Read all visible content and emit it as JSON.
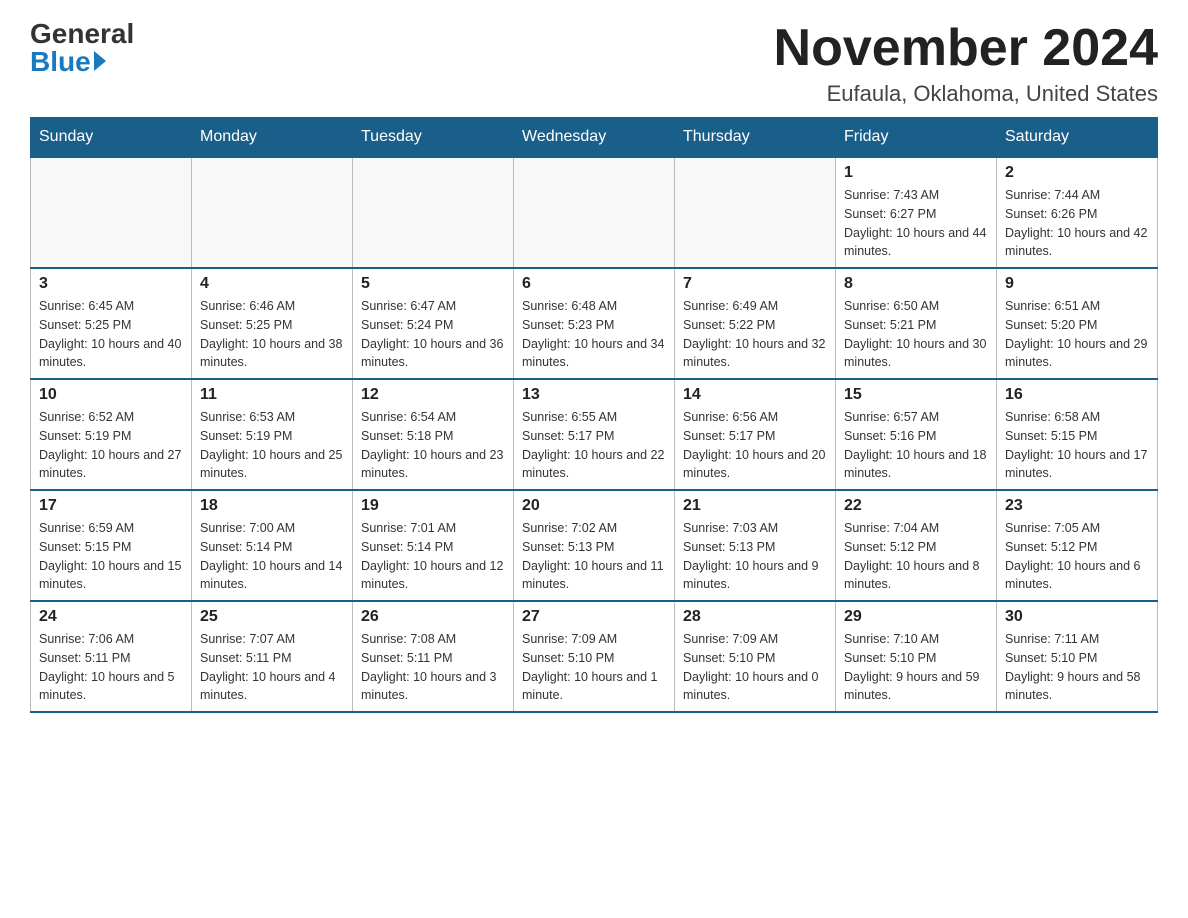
{
  "header": {
    "logo_general": "General",
    "logo_blue": "Blue",
    "month_title": "November 2024",
    "location": "Eufaula, Oklahoma, United States"
  },
  "weekdays": [
    "Sunday",
    "Monday",
    "Tuesday",
    "Wednesday",
    "Thursday",
    "Friday",
    "Saturday"
  ],
  "weeks": [
    [
      {
        "day": "",
        "info": ""
      },
      {
        "day": "",
        "info": ""
      },
      {
        "day": "",
        "info": ""
      },
      {
        "day": "",
        "info": ""
      },
      {
        "day": "",
        "info": ""
      },
      {
        "day": "1",
        "info": "Sunrise: 7:43 AM\nSunset: 6:27 PM\nDaylight: 10 hours and 44 minutes."
      },
      {
        "day": "2",
        "info": "Sunrise: 7:44 AM\nSunset: 6:26 PM\nDaylight: 10 hours and 42 minutes."
      }
    ],
    [
      {
        "day": "3",
        "info": "Sunrise: 6:45 AM\nSunset: 5:25 PM\nDaylight: 10 hours and 40 minutes."
      },
      {
        "day": "4",
        "info": "Sunrise: 6:46 AM\nSunset: 5:25 PM\nDaylight: 10 hours and 38 minutes."
      },
      {
        "day": "5",
        "info": "Sunrise: 6:47 AM\nSunset: 5:24 PM\nDaylight: 10 hours and 36 minutes."
      },
      {
        "day": "6",
        "info": "Sunrise: 6:48 AM\nSunset: 5:23 PM\nDaylight: 10 hours and 34 minutes."
      },
      {
        "day": "7",
        "info": "Sunrise: 6:49 AM\nSunset: 5:22 PM\nDaylight: 10 hours and 32 minutes."
      },
      {
        "day": "8",
        "info": "Sunrise: 6:50 AM\nSunset: 5:21 PM\nDaylight: 10 hours and 30 minutes."
      },
      {
        "day": "9",
        "info": "Sunrise: 6:51 AM\nSunset: 5:20 PM\nDaylight: 10 hours and 29 minutes."
      }
    ],
    [
      {
        "day": "10",
        "info": "Sunrise: 6:52 AM\nSunset: 5:19 PM\nDaylight: 10 hours and 27 minutes."
      },
      {
        "day": "11",
        "info": "Sunrise: 6:53 AM\nSunset: 5:19 PM\nDaylight: 10 hours and 25 minutes."
      },
      {
        "day": "12",
        "info": "Sunrise: 6:54 AM\nSunset: 5:18 PM\nDaylight: 10 hours and 23 minutes."
      },
      {
        "day": "13",
        "info": "Sunrise: 6:55 AM\nSunset: 5:17 PM\nDaylight: 10 hours and 22 minutes."
      },
      {
        "day": "14",
        "info": "Sunrise: 6:56 AM\nSunset: 5:17 PM\nDaylight: 10 hours and 20 minutes."
      },
      {
        "day": "15",
        "info": "Sunrise: 6:57 AM\nSunset: 5:16 PM\nDaylight: 10 hours and 18 minutes."
      },
      {
        "day": "16",
        "info": "Sunrise: 6:58 AM\nSunset: 5:15 PM\nDaylight: 10 hours and 17 minutes."
      }
    ],
    [
      {
        "day": "17",
        "info": "Sunrise: 6:59 AM\nSunset: 5:15 PM\nDaylight: 10 hours and 15 minutes."
      },
      {
        "day": "18",
        "info": "Sunrise: 7:00 AM\nSunset: 5:14 PM\nDaylight: 10 hours and 14 minutes."
      },
      {
        "day": "19",
        "info": "Sunrise: 7:01 AM\nSunset: 5:14 PM\nDaylight: 10 hours and 12 minutes."
      },
      {
        "day": "20",
        "info": "Sunrise: 7:02 AM\nSunset: 5:13 PM\nDaylight: 10 hours and 11 minutes."
      },
      {
        "day": "21",
        "info": "Sunrise: 7:03 AM\nSunset: 5:13 PM\nDaylight: 10 hours and 9 minutes."
      },
      {
        "day": "22",
        "info": "Sunrise: 7:04 AM\nSunset: 5:12 PM\nDaylight: 10 hours and 8 minutes."
      },
      {
        "day": "23",
        "info": "Sunrise: 7:05 AM\nSunset: 5:12 PM\nDaylight: 10 hours and 6 minutes."
      }
    ],
    [
      {
        "day": "24",
        "info": "Sunrise: 7:06 AM\nSunset: 5:11 PM\nDaylight: 10 hours and 5 minutes."
      },
      {
        "day": "25",
        "info": "Sunrise: 7:07 AM\nSunset: 5:11 PM\nDaylight: 10 hours and 4 minutes."
      },
      {
        "day": "26",
        "info": "Sunrise: 7:08 AM\nSunset: 5:11 PM\nDaylight: 10 hours and 3 minutes."
      },
      {
        "day": "27",
        "info": "Sunrise: 7:09 AM\nSunset: 5:10 PM\nDaylight: 10 hours and 1 minute."
      },
      {
        "day": "28",
        "info": "Sunrise: 7:09 AM\nSunset: 5:10 PM\nDaylight: 10 hours and 0 minutes."
      },
      {
        "day": "29",
        "info": "Sunrise: 7:10 AM\nSunset: 5:10 PM\nDaylight: 9 hours and 59 minutes."
      },
      {
        "day": "30",
        "info": "Sunrise: 7:11 AM\nSunset: 5:10 PM\nDaylight: 9 hours and 58 minutes."
      }
    ]
  ]
}
